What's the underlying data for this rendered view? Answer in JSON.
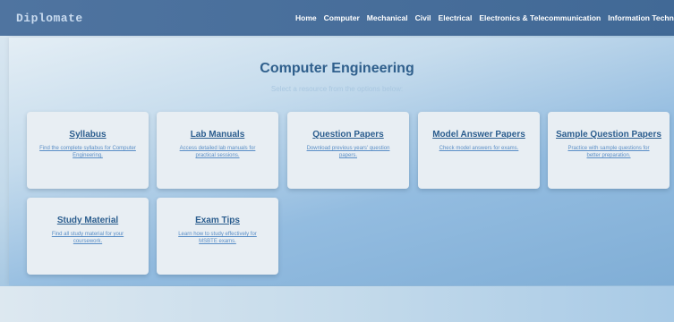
{
  "brand": "Diplomate",
  "nav": [
    "Home",
    "Computer",
    "Mechanical",
    "Civil",
    "Electrical",
    "Electronics & Telecommunication",
    "Information Technolog"
  ],
  "page": {
    "title": "Computer Engineering",
    "subtitle": "Select a resource from the options below:"
  },
  "cards": [
    {
      "title": "Syllabus",
      "desc": "Find the complete syllabus for Computer Engineering."
    },
    {
      "title": "Lab Manuals",
      "desc": "Access detailed lab manuals for practical sessions."
    },
    {
      "title": "Question Papers",
      "desc": "Download previous years' question papers."
    },
    {
      "title": "Model Answer Papers",
      "desc": "Check model answers for exams."
    },
    {
      "title": "Sample Question Papers",
      "desc": "Practice with sample questions for better preparation."
    },
    {
      "title": "Study Material",
      "desc": "Find all study material for your coursework."
    },
    {
      "title": "Exam Tips",
      "desc": "Learn how to study effectively for MSBTE exams."
    }
  ]
}
